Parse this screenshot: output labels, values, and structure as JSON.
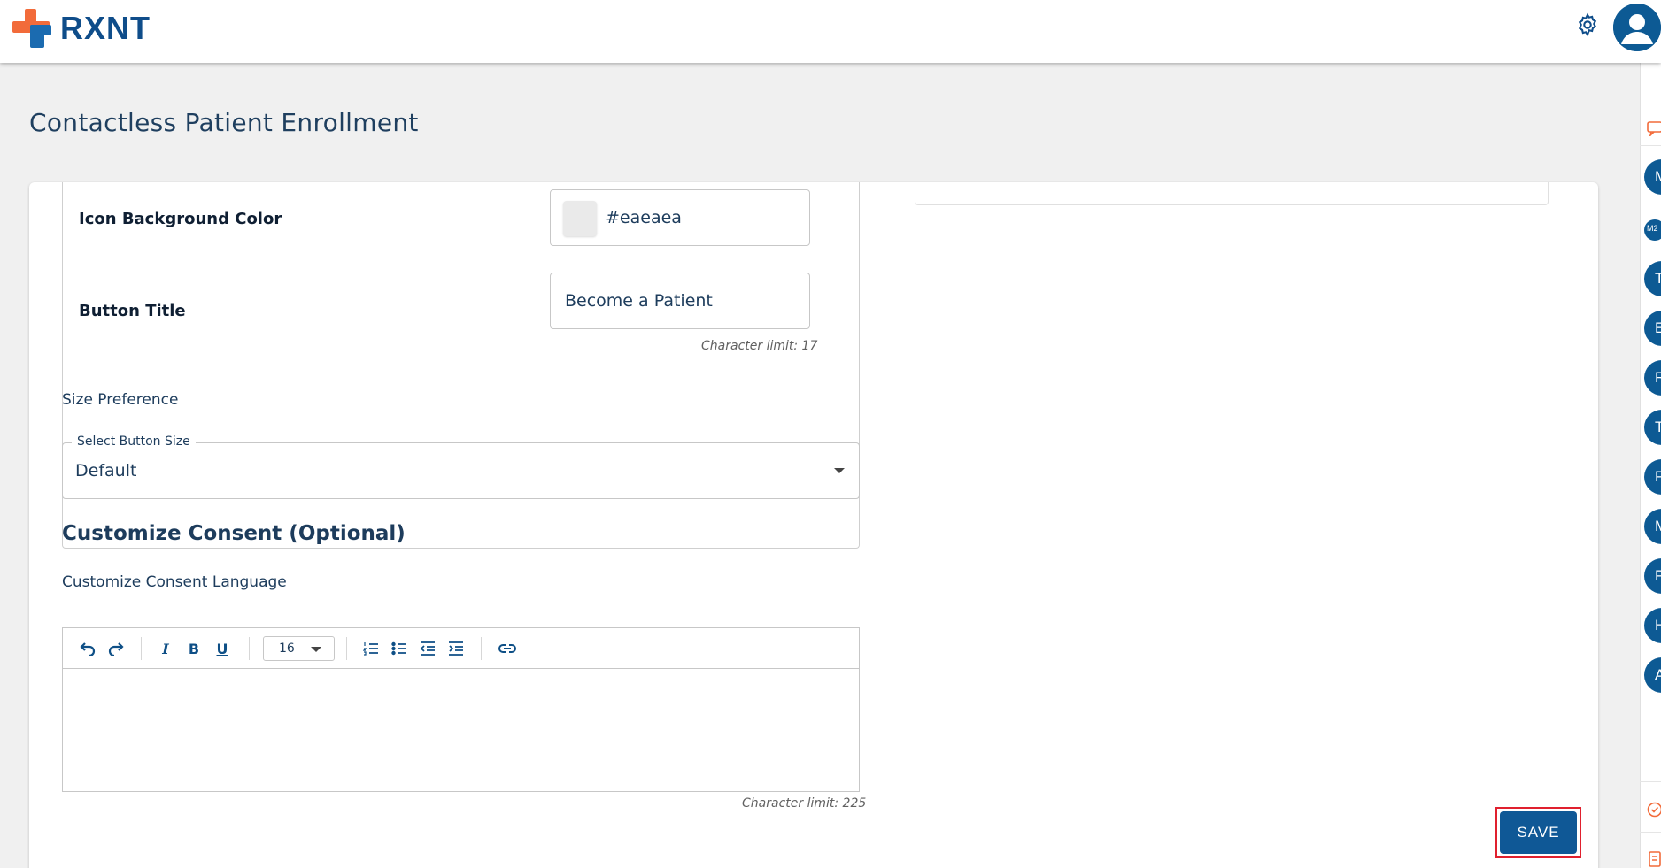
{
  "header": {
    "brand": "RXNT",
    "settings_icon": "gear-icon",
    "user_icon": "user-avatar-icon"
  },
  "page": {
    "title": "Contactless Patient Enrollment"
  },
  "appearance": {
    "icon_bg_label": "Icon Background Color",
    "icon_bg_value": "#eaeaea",
    "icon_bg_swatch": "#eaeaea",
    "button_title_label": "Button Title",
    "button_title_value": "Become a Patient",
    "button_title_limit": "Character limit: 17"
  },
  "size": {
    "section_label": "Size Preference",
    "select_legend": "Select Button Size",
    "select_value": "Default"
  },
  "consent": {
    "heading": "Customize Consent (Optional)",
    "language_label": "Customize Consent Language",
    "font_size": "16",
    "limit": "Character limit: 225",
    "toolbar": {
      "undo": "undo-icon",
      "redo": "redo-icon",
      "italic": "I",
      "bold": "B",
      "underline": "U",
      "ordered_list": "ordered-list-icon",
      "bullet_list": "bullet-list-icon",
      "outdent": "outdent-icon",
      "indent": "indent-icon",
      "link": "link-icon"
    }
  },
  "actions": {
    "save_label": "SAVE"
  },
  "colors": {
    "primary": "#0f5896",
    "brand_orange": "#f26b3a",
    "highlight_red": "#e0202e"
  },
  "side_avatars": [
    "M",
    "M2",
    "T",
    "E",
    "R",
    "T",
    "P",
    "M",
    "P",
    "H",
    "A"
  ]
}
